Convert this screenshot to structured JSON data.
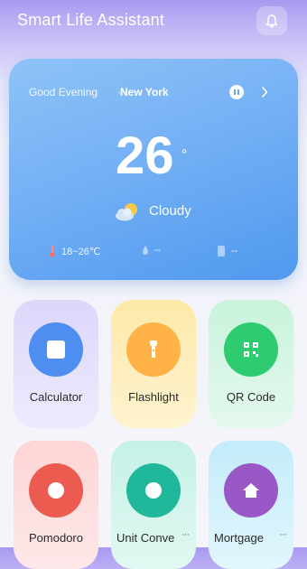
{
  "header": {
    "title": "Smart Life Assistant",
    "bell_icon": "bell-icon"
  },
  "weather": {
    "greeting": "Good Evening",
    "separator": "·",
    "city": "New York",
    "temperature": "26",
    "degree": "°",
    "condition": "Cloudy",
    "condition_icon": "partly-cloudy-icon",
    "temp_range": "18~26℃",
    "humidity": "--",
    "air_quality": "--",
    "accent": "#4f99ee"
  },
  "tools": [
    {
      "label": "Calculator",
      "icon": "calculator-icon",
      "color": "#4d8ef0"
    },
    {
      "label": "Flashlight",
      "icon": "flashlight-icon",
      "color": "#ffb347"
    },
    {
      "label": "QR Code",
      "icon": "qr-code-icon",
      "color": "#2ecc71"
    },
    {
      "label": "Pomodoro",
      "icon": "timer-icon",
      "color": "#ec5b50"
    },
    {
      "label": "Unit Conve",
      "icon": "unit-convert-icon",
      "color": "#1fb89a",
      "more": "···"
    },
    {
      "label": "Mortgage",
      "icon": "home-icon",
      "color": "#9a57c6",
      "more": "···"
    }
  ]
}
